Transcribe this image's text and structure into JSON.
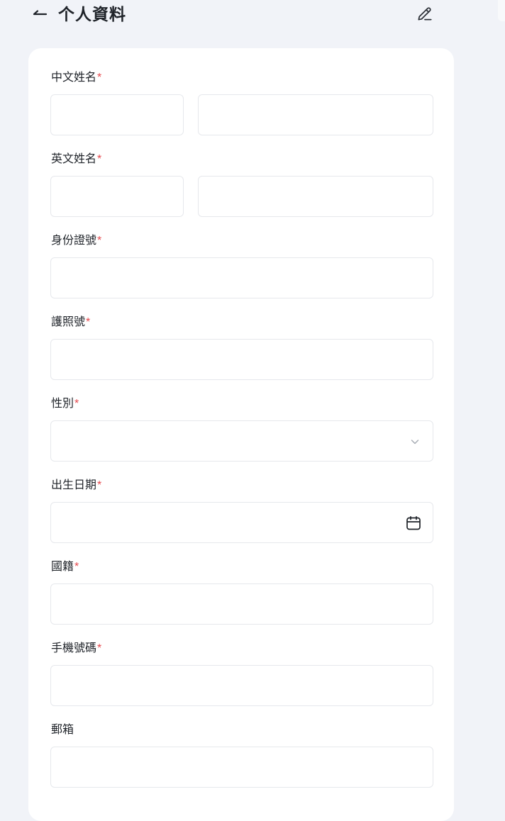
{
  "header": {
    "title": "个人資料"
  },
  "form": {
    "chinese_name": {
      "label": "中文姓名",
      "required_mark": "*",
      "surname_value": "",
      "given_value": ""
    },
    "english_name": {
      "label": "英文姓名",
      "required_mark": "*",
      "surname_value": "",
      "given_value": ""
    },
    "id_number": {
      "label": "身份證號",
      "required_mark": "*",
      "value": ""
    },
    "passport_number": {
      "label": "護照號",
      "required_mark": "*",
      "value": ""
    },
    "gender": {
      "label": "性別",
      "required_mark": "*",
      "value": ""
    },
    "birth_date": {
      "label": "出生日期",
      "required_mark": "*",
      "value": ""
    },
    "nationality": {
      "label": "國籍",
      "required_mark": "*",
      "value": ""
    },
    "phone": {
      "label": "手機號碼",
      "required_mark": "*",
      "country_code": "",
      "value": ""
    },
    "email": {
      "label": "郵箱",
      "value": ""
    }
  },
  "icons": {
    "back": "back-arrow-icon",
    "edit": "pencil-icon",
    "select": "chevron-down-icon",
    "calendar": "calendar-icon"
  },
  "colors": {
    "background": "#f1f3f8",
    "card": "#ffffff",
    "required": "#e5484d",
    "border": "#e6e8ec",
    "text": "#1f2329"
  }
}
